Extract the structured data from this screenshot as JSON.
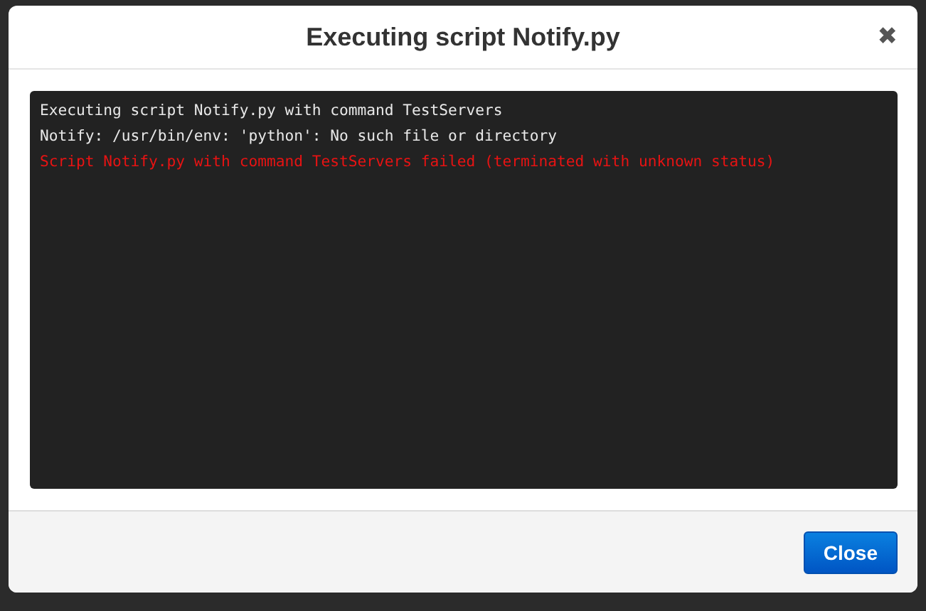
{
  "dialog": {
    "title": "Executing script Notify.py",
    "close_icon": "✖"
  },
  "log": [
    {
      "kind": "info",
      "text": "Executing script Notify.py with command TestServers"
    },
    {
      "kind": "info",
      "text": "Notify: /usr/bin/env: 'python': No such file or directory"
    },
    {
      "kind": "error",
      "text": "Script Notify.py with command TestServers failed (terminated with unknown status)"
    }
  ],
  "buttons": [
    "Close"
  ]
}
